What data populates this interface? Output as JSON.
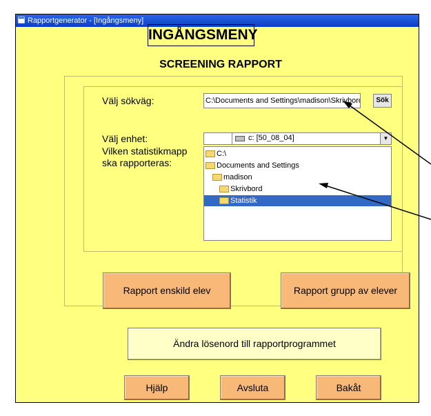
{
  "window": {
    "title": "Rapportgenerator - [Ingångsmeny]"
  },
  "header": {
    "title": "INGÅNGSMENY",
    "subtitle": "SCREENING RAPPORT"
  },
  "path": {
    "label": "Välj sökväg:",
    "value": "C:\\Documents and Settings\\madison\\Skrivbord",
    "search_button": "Sök"
  },
  "drive": {
    "label": "Välj enhet:",
    "selected": "c: [50_08_04]"
  },
  "folder": {
    "label_line1": "Vilken statistikmapp",
    "label_line2": "ska rapporteras:",
    "items": [
      {
        "name": "C:\\"
      },
      {
        "name": "Documents and Settings"
      },
      {
        "name": "madison"
      },
      {
        "name": "Skrivbord"
      },
      {
        "name": "Statistik"
      }
    ]
  },
  "buttons": {
    "report_single": "Rapport enskild elev",
    "report_group": "Rapport grupp av elever",
    "change_password": "Ändra lösenord till rapportprogrammet",
    "help": "Hjälp",
    "quit": "Avsluta",
    "back": "Bakåt"
  }
}
